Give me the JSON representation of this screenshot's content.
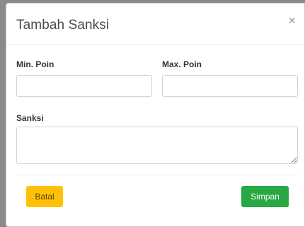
{
  "modal": {
    "title": "Tambah Sanksi",
    "close_symbol": "×",
    "fields": {
      "min_poin": {
        "label": "Min. Poin",
        "value": "",
        "placeholder": ""
      },
      "max_poin": {
        "label": "Max. Poin",
        "value": "",
        "placeholder": ""
      },
      "sanksi": {
        "label": "Sanksi",
        "value": "",
        "placeholder": ""
      }
    },
    "buttons": {
      "cancel_label": "Batal",
      "save_label": "Simpan"
    },
    "colors": {
      "cancel": "#ffc107",
      "save": "#28a745"
    }
  }
}
